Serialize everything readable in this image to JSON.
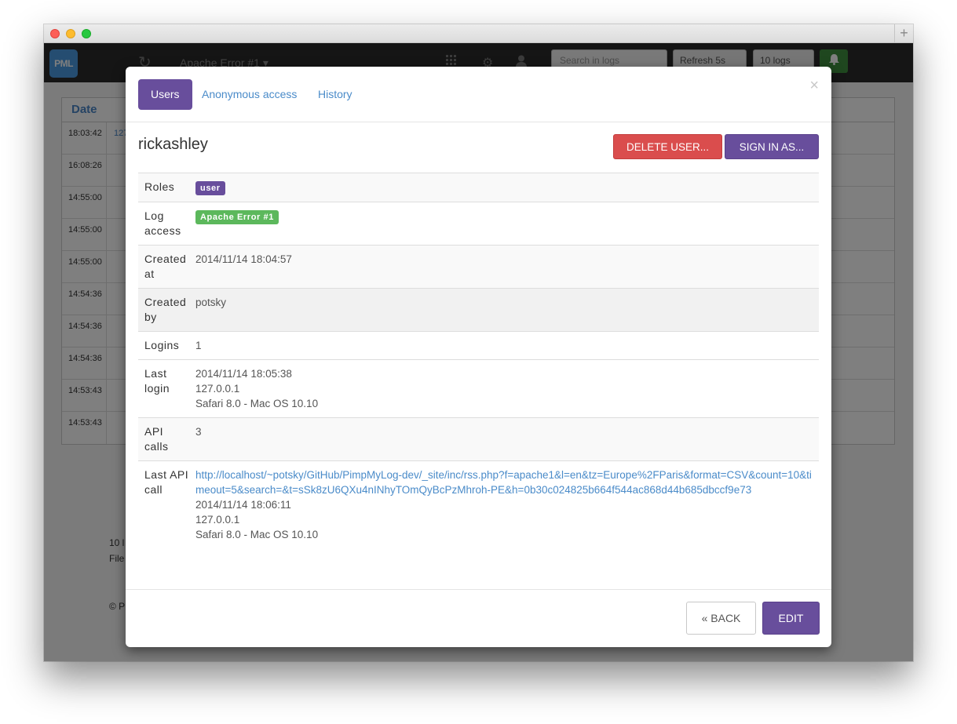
{
  "window": {
    "new_tab": "+"
  },
  "navbar": {
    "logo_text": "PML",
    "refresh_icon": "↻",
    "title": "Apache Error #1 ▾",
    "search_placeholder": "Search in logs",
    "refresh_select": "Refresh 5s",
    "count_select": "10 logs",
    "bell_icon": "bell-icon"
  },
  "background_table": {
    "header": "Date",
    "first_cell_link": "127",
    "times": [
      "18:03:42",
      "16:08:26",
      "14:55:00",
      "14:55:00",
      "14:55:00",
      "14:54:36",
      "14:54:36",
      "14:54:36",
      "14:53:43",
      "14:53:43"
    ],
    "footer_line1": "10 l",
    "footer_line2": "File",
    "copyright": "© P"
  },
  "modal": {
    "tabs": [
      "Users",
      "Anonymous access",
      "History"
    ],
    "close": "×",
    "username": "rickashley",
    "delete_button": "Delete user...",
    "signin_button": "Sign in as...",
    "rows": {
      "roles": {
        "label": "Roles",
        "badge": "user"
      },
      "log_access": {
        "label": "Log access",
        "badge": "Apache Error #1"
      },
      "created_at": {
        "label": "Created at",
        "value": "2014/11/14 18:04:57"
      },
      "created_by": {
        "label": "Created by",
        "value": "potsky"
      },
      "logins": {
        "label": "Logins",
        "value": "1"
      },
      "last_login": {
        "label": "Last login",
        "date": "2014/11/14 18:05:38",
        "ip": "127.0.0.1",
        "agent": "Safari 8.0 - Mac OS 10.10"
      },
      "api_calls": {
        "label": "API calls",
        "value": "3"
      },
      "last_api_call": {
        "label": "Last API call",
        "url": "http://localhost/~potsky/GitHub/PimpMyLog-dev/_site/inc/rss.php?f=apache1&l=en&tz=Europe%2FParis&format=CSV&count=10&timeout=5&search=&t=sSk8zU6QXu4nINhyTOmQyBcPzMhroh-PE&h=0b30c024825b664f544ac868d44b685dbccf9e73",
        "date": "2014/11/14 18:06:11",
        "ip": "127.0.0.1",
        "agent": "Safari 8.0 - Mac OS 10.10"
      }
    },
    "back_button": "« Back",
    "edit_button": "Edit"
  },
  "colors": {
    "primary": "#684e9c",
    "danger": "#da4d4d",
    "success": "#5cb85c",
    "link": "#4a8bc9"
  }
}
